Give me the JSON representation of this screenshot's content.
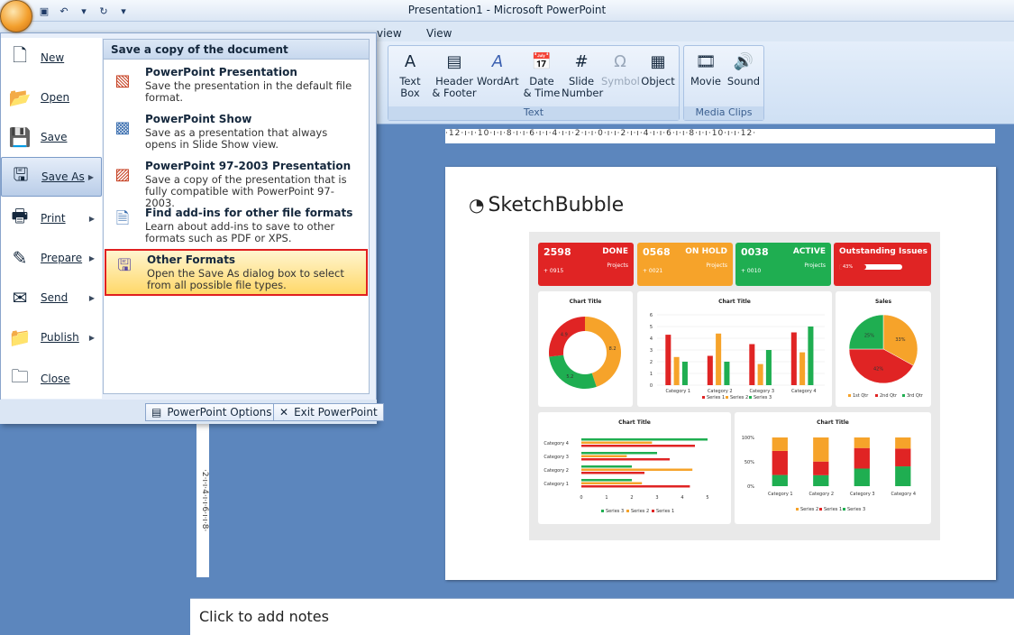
{
  "window": {
    "title": "Presentation1 - Microsoft PowerPoint"
  },
  "ribbon": {
    "tabs": [
      "view",
      "View"
    ],
    "text_group": {
      "label": "Text",
      "buttons": [
        {
          "label": "Text\nBox",
          "icon": "text-box-icon"
        },
        {
          "label": "Header\n& Footer",
          "icon": "header-footer-icon"
        },
        {
          "label": "WordArt",
          "icon": "wordart-icon"
        },
        {
          "label": "Date\n& Time",
          "icon": "date-time-icon"
        },
        {
          "label": "Slide\nNumber",
          "icon": "slide-number-icon"
        },
        {
          "label": "Symbol",
          "icon": "symbol-icon"
        },
        {
          "label": "Object",
          "icon": "object-icon"
        }
      ]
    },
    "media_group": {
      "label": "Media Clips",
      "buttons": [
        {
          "label": "Movie",
          "icon": "movie-icon"
        },
        {
          "label": "Sound",
          "icon": "sound-icon"
        }
      ]
    }
  },
  "ruler": {
    "text": "·12·ı·ı·10·ı·ı·8·ı·ı·6·ı·ı·4·ı·ı·2·ı·ı·0·ı·ı·2·ı·ı·4·ı·ı·6·ı·ı·8·ı·ı·10·ı·ı·12·",
    "vtext": "·2·ı·ı·4·ı·ı·6·ı·ı·8·"
  },
  "office_menu": {
    "items": [
      {
        "label": "New",
        "icon": "new-doc-icon"
      },
      {
        "label": "Open",
        "icon": "open-folder-icon"
      },
      {
        "label": "Save",
        "icon": "save-icon"
      },
      {
        "label": "Save As",
        "icon": "save-as-icon"
      },
      {
        "label": "Print",
        "icon": "print-icon"
      },
      {
        "label": "Prepare",
        "icon": "prepare-icon"
      },
      {
        "label": "Send",
        "icon": "send-icon"
      },
      {
        "label": "Publish",
        "icon": "publish-icon"
      },
      {
        "label": "Close",
        "icon": "close-folder-icon"
      }
    ],
    "submenu": {
      "heading": "Save a copy of the document",
      "items": [
        {
          "title": "PowerPoint Presentation",
          "desc": "Save the presentation in the default file format.",
          "icon": "pptx-icon"
        },
        {
          "title": "PowerPoint Show",
          "desc": "Save as a presentation that always opens in Slide Show view.",
          "icon": "ppt-show-icon"
        },
        {
          "title": "PowerPoint 97-2003 Presentation",
          "desc": "Save a copy of the presentation that is fully compatible with PowerPoint 97-2003.",
          "icon": "ppt-97-icon"
        },
        {
          "title": "Find add-ins for other file formats",
          "desc": "Learn about add-ins to save to other formats such as PDF or XPS.",
          "icon": "addins-icon"
        },
        {
          "title": "Other Formats",
          "desc": "Open the Save As dialog box to select from all possible file types.",
          "icon": "other-formats-icon"
        }
      ]
    },
    "options_button": "PowerPoint Options",
    "exit_button": "Exit PowerPoint"
  },
  "slide": {
    "logo": "SketchBubble",
    "kpis": [
      {
        "value": "2598",
        "label": "DONE",
        "sub": "+ 0915",
        "sub2": "Projects",
        "color": "#e02424"
      },
      {
        "value": "0568",
        "label": "ON HOLD",
        "sub": "+ 0021",
        "sub2": "Projects",
        "color": "#f6a32a"
      },
      {
        "value": "0038",
        "label": "ACTIVE",
        "sub": "+ 0010",
        "sub2": "Projects",
        "color": "#1fae51"
      },
      {
        "value": "",
        "label": "Outstanding Issues",
        "sub": "43%",
        "sub2": "",
        "color": "#e02424"
      }
    ],
    "chart_titles": [
      "Chart Title",
      "Chart Title",
      "Sales",
      "Chart Title",
      "Chart Title"
    ],
    "legend_series": [
      "Series 1",
      "Series 2",
      "Series 3"
    ],
    "legend_qtr": [
      "1st Qtr",
      "2nd Qtr",
      "3rd Qtr"
    ]
  },
  "chart_data": [
    {
      "type": "pie",
      "title": "Chart Title",
      "categories": [
        "Series 1",
        "Series 2",
        "Series 3"
      ],
      "values": [
        4.9,
        8.2,
        5.2
      ]
    },
    {
      "type": "bar",
      "title": "Chart Title",
      "categories": [
        "Category 1",
        "Category 2",
        "Category 3",
        "Category 4"
      ],
      "series": [
        {
          "name": "Series 1",
          "values": [
            4.3,
            2.5,
            3.5,
            4.5
          ]
        },
        {
          "name": "Series 2",
          "values": [
            2.4,
            4.4,
            1.8,
            2.8
          ]
        },
        {
          "name": "Series 3",
          "values": [
            2,
            2,
            3,
            5
          ]
        }
      ],
      "ylim": [
        0,
        6
      ]
    },
    {
      "type": "pie",
      "title": "Sales",
      "categories": [
        "1st Qtr",
        "2nd Qtr",
        "3rd Qtr"
      ],
      "values": [
        42,
        33,
        25
      ]
    },
    {
      "type": "bar",
      "title": "Chart Title",
      "orientation": "horizontal",
      "categories": [
        "Category 1",
        "Category 2",
        "Category 3",
        "Category 4"
      ],
      "series": [
        {
          "name": "Series 1",
          "values": [
            4.3,
            2.5,
            3.5,
            4.5
          ]
        },
        {
          "name": "Series 2",
          "values": [
            2.4,
            4.4,
            1.8,
            2.8
          ]
        },
        {
          "name": "Series 3",
          "values": [
            2,
            2,
            3,
            5
          ]
        }
      ],
      "xlim": [
        0,
        6
      ]
    },
    {
      "type": "bar",
      "title": "Chart Title",
      "stacked": "percent",
      "categories": [
        "Category 1",
        "Category 2",
        "Category 3",
        "Category 4"
      ],
      "series": [
        {
          "name": "Series 1",
          "values": [
            4.3,
            2.5,
            3.5,
            4.5
          ]
        },
        {
          "name": "Series 2",
          "values": [
            2.4,
            4.4,
            1.8,
            2.8
          ]
        },
        {
          "name": "Series 3",
          "values": [
            2,
            2,
            3,
            5
          ]
        }
      ],
      "ylim": [
        0,
        100
      ]
    }
  ],
  "notes": {
    "placeholder": "Click to add notes"
  }
}
